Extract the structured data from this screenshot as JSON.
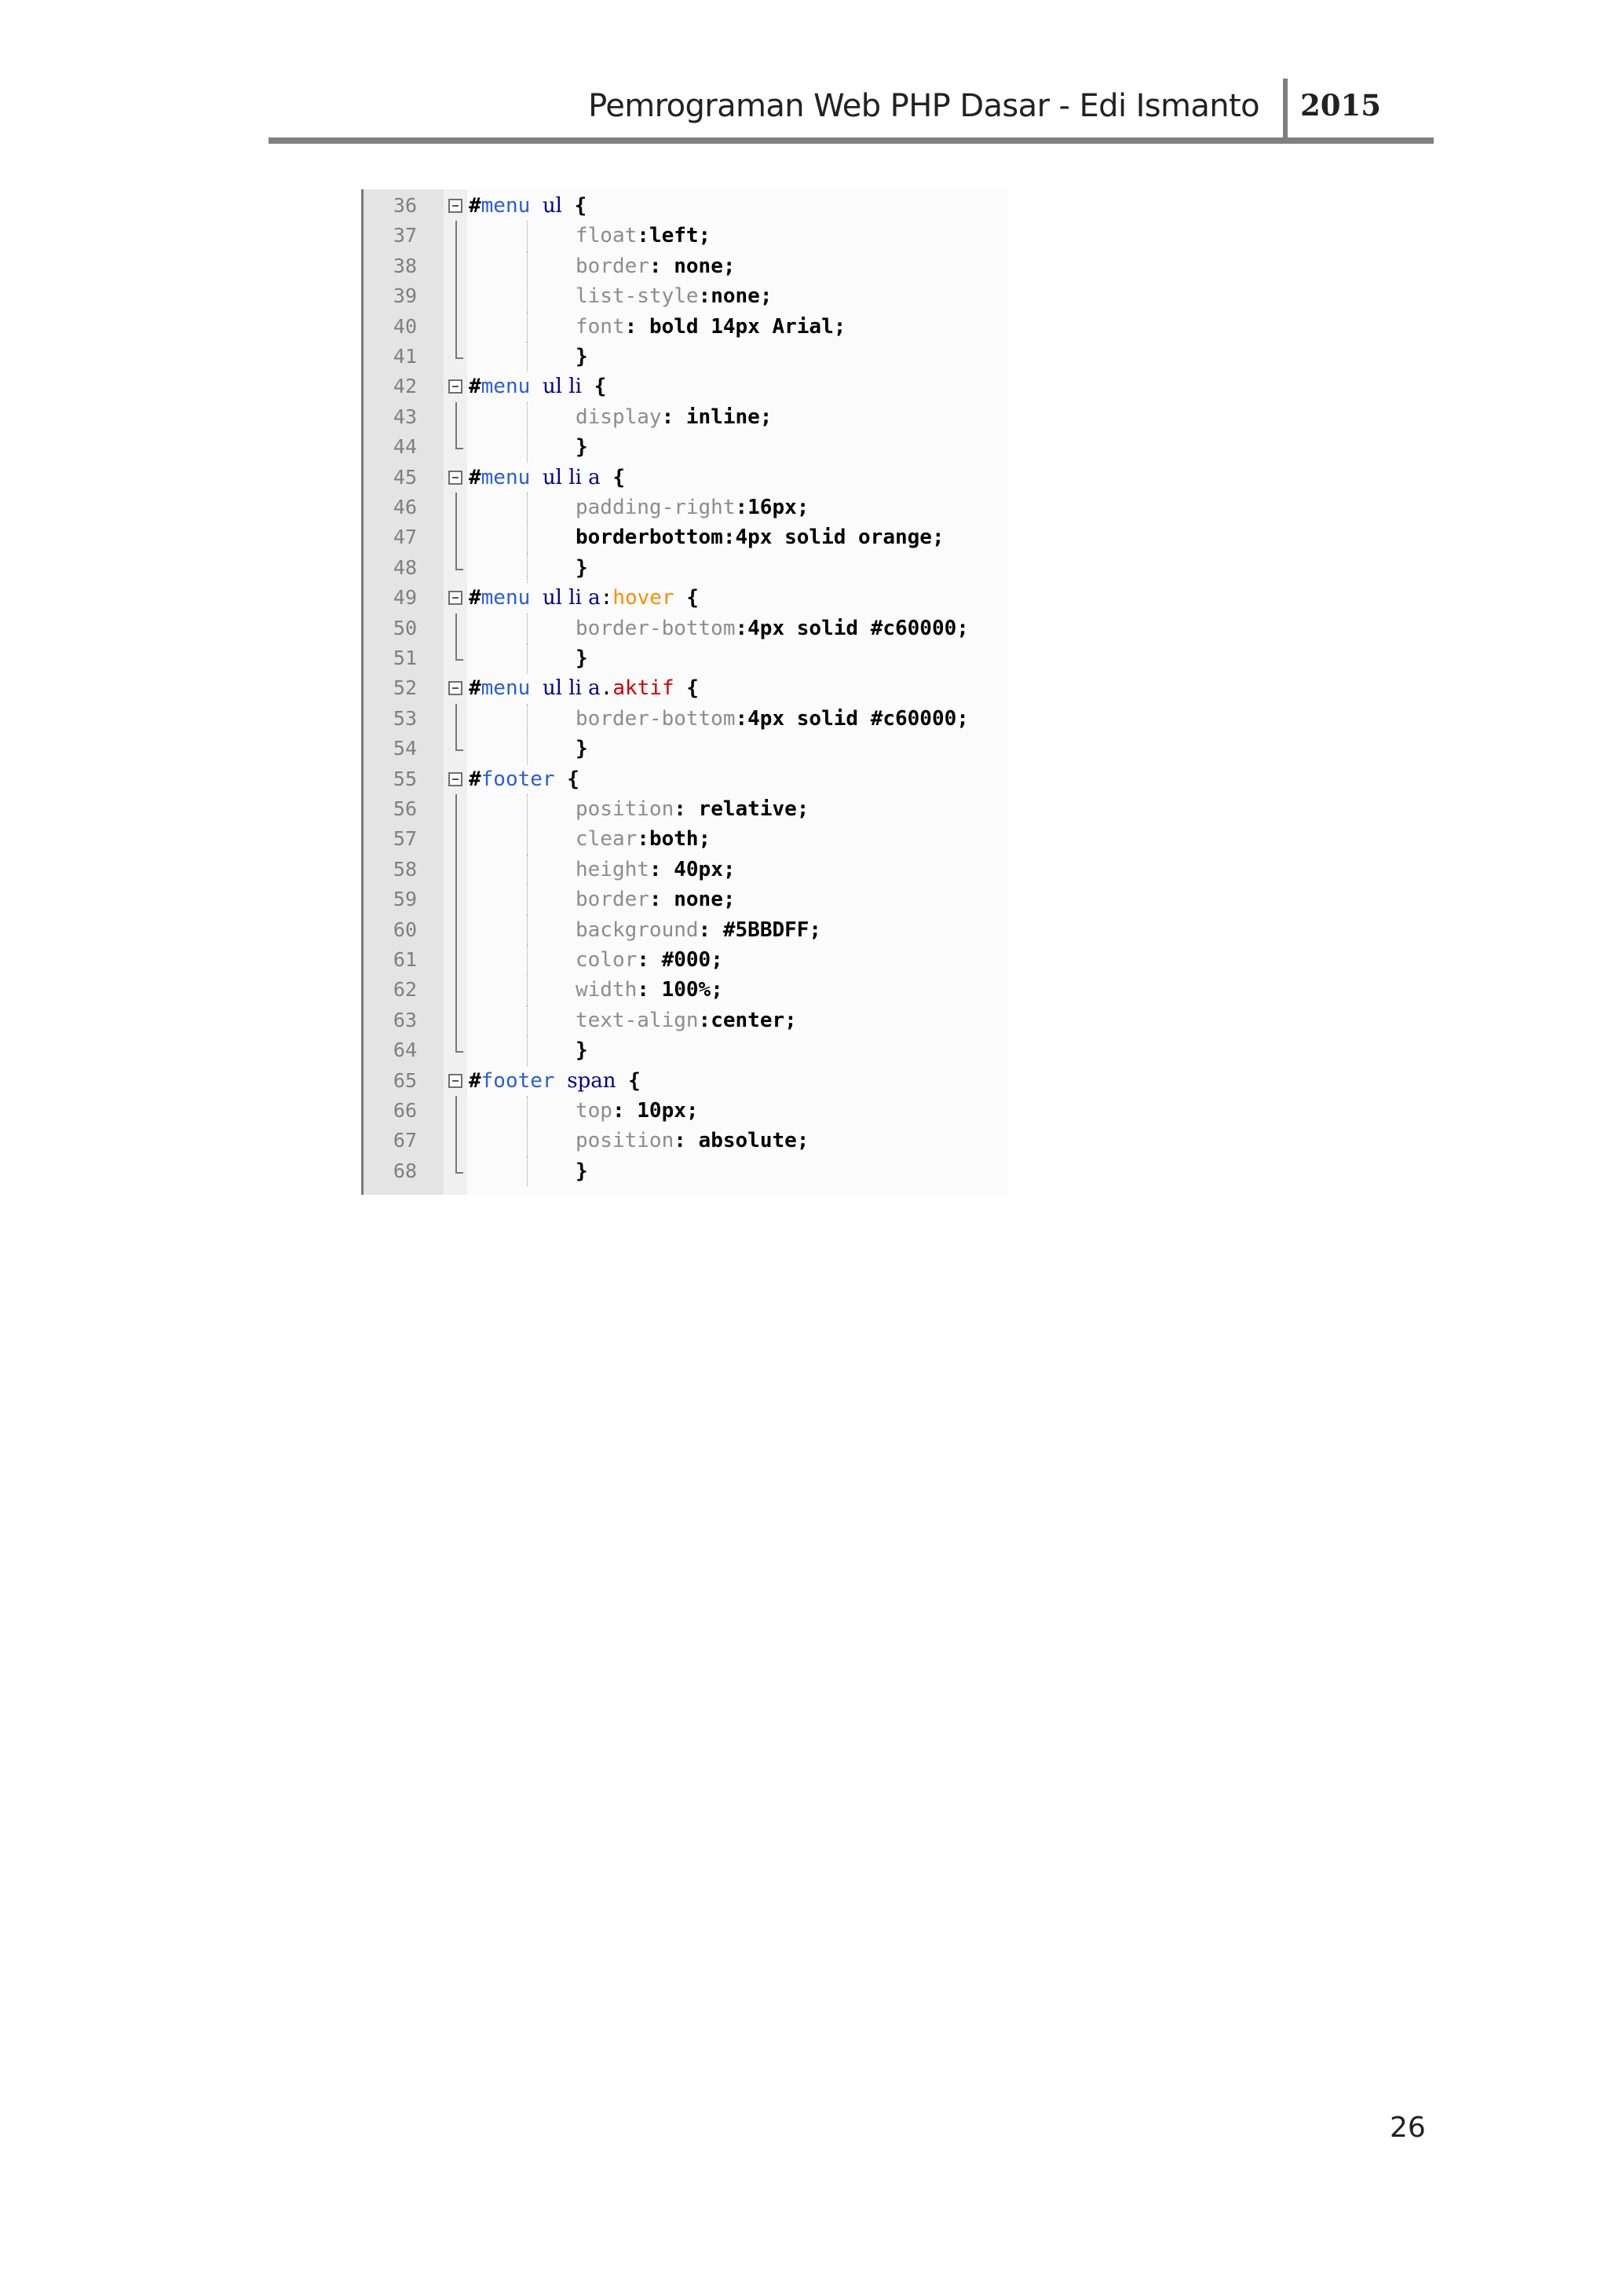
{
  "header": {
    "title": "Pemrograman Web PHP Dasar - Edi Ismanto",
    "year": "2015"
  },
  "code": [
    {
      "num": "36",
      "kind": "selector",
      "sel": [
        {
          "c": "sel-hash",
          "t": "#"
        },
        {
          "c": "sel-name",
          "t": "menu"
        },
        {
          "c": "",
          "t": " "
        },
        {
          "c": "sel-tag",
          "t": "ul"
        },
        {
          "c": "",
          "t": " "
        },
        {
          "c": "brace",
          "t": "{"
        }
      ]
    },
    {
      "num": "37",
      "kind": "decl",
      "prop": "float",
      "sep": ":",
      "val": "left;"
    },
    {
      "num": "38",
      "kind": "decl",
      "prop": "border",
      "sep": ": ",
      "val": "none;"
    },
    {
      "num": "39",
      "kind": "decl",
      "prop": "list-style",
      "sep": ":",
      "val": "none;"
    },
    {
      "num": "40",
      "kind": "decl",
      "prop": "font",
      "sep": ": ",
      "val": "bold 14px Arial;"
    },
    {
      "num": "41",
      "kind": "close",
      "val": "}"
    },
    {
      "num": "42",
      "kind": "selector",
      "sel": [
        {
          "c": "sel-hash",
          "t": "#"
        },
        {
          "c": "sel-name",
          "t": "menu"
        },
        {
          "c": "",
          "t": " "
        },
        {
          "c": "sel-tag",
          "t": "ul li"
        },
        {
          "c": "",
          "t": " "
        },
        {
          "c": "brace",
          "t": "{"
        }
      ]
    },
    {
      "num": "43",
      "kind": "decl",
      "prop": "display",
      "sep": ": ",
      "val": "inline;"
    },
    {
      "num": "44",
      "kind": "close",
      "val": "}"
    },
    {
      "num": "45",
      "kind": "selector",
      "sel": [
        {
          "c": "sel-hash",
          "t": "#"
        },
        {
          "c": "sel-name",
          "t": "menu"
        },
        {
          "c": "",
          "t": " "
        },
        {
          "c": "sel-tag",
          "t": "ul li a"
        },
        {
          "c": "",
          "t": " "
        },
        {
          "c": "brace",
          "t": "{"
        }
      ]
    },
    {
      "num": "46",
      "kind": "decl",
      "prop": "padding-right",
      "sep": ":",
      "val": "16px;"
    },
    {
      "num": "47",
      "kind": "decl",
      "prop": "",
      "sep": "",
      "val": "borderbottom:4px solid orange;"
    },
    {
      "num": "48",
      "kind": "close",
      "val": "}"
    },
    {
      "num": "49",
      "kind": "selector",
      "sel": [
        {
          "c": "sel-hash",
          "t": "#"
        },
        {
          "c": "sel-name",
          "t": "menu"
        },
        {
          "c": "",
          "t": " "
        },
        {
          "c": "sel-tag",
          "t": "ul li a"
        },
        {
          "c": "",
          "t": ":"
        },
        {
          "c": "pseudo",
          "t": "hover"
        },
        {
          "c": "",
          "t": " "
        },
        {
          "c": "brace",
          "t": "{"
        }
      ]
    },
    {
      "num": "50",
      "kind": "decl",
      "prop": "border-bottom",
      "sep": ":",
      "val": "4px solid #c60000;"
    },
    {
      "num": "51",
      "kind": "close",
      "val": "}"
    },
    {
      "num": "52",
      "kind": "selector",
      "sel": [
        {
          "c": "sel-hash",
          "t": "#"
        },
        {
          "c": "sel-name",
          "t": "menu"
        },
        {
          "c": "",
          "t": " "
        },
        {
          "c": "sel-tag",
          "t": "ul li a"
        },
        {
          "c": "",
          "t": "."
        },
        {
          "c": "cls",
          "t": "aktif"
        },
        {
          "c": "",
          "t": " "
        },
        {
          "c": "brace",
          "t": "{"
        }
      ]
    },
    {
      "num": "53",
      "kind": "decl",
      "prop": "border-bottom",
      "sep": ":",
      "val": "4px solid #c60000;"
    },
    {
      "num": "54",
      "kind": "close",
      "val": "}"
    },
    {
      "num": "55",
      "kind": "selector",
      "sel": [
        {
          "c": "sel-hash",
          "t": "#"
        },
        {
          "c": "sel-name",
          "t": "footer"
        },
        {
          "c": "",
          "t": " "
        },
        {
          "c": "brace",
          "t": "{"
        }
      ]
    },
    {
      "num": "56",
      "kind": "decl",
      "prop": "position",
      "sep": ": ",
      "val": "relative;"
    },
    {
      "num": "57",
      "kind": "decl",
      "prop": "clear",
      "sep": ":",
      "val": "both;"
    },
    {
      "num": "58",
      "kind": "decl",
      "prop": "height",
      "sep": ": ",
      "val": "40px;"
    },
    {
      "num": "59",
      "kind": "decl",
      "prop": "border",
      "sep": ": ",
      "val": "none;"
    },
    {
      "num": "60",
      "kind": "decl",
      "prop": "background",
      "sep": ": ",
      "val": "#5BBDFF;"
    },
    {
      "num": "61",
      "kind": "decl",
      "prop": "color",
      "sep": ": ",
      "val": "#000;"
    },
    {
      "num": "62",
      "kind": "decl",
      "prop": "width",
      "sep": ": ",
      "val": "100%;"
    },
    {
      "num": "63",
      "kind": "decl",
      "prop": "text-align",
      "sep": ":",
      "val": "center;"
    },
    {
      "num": "64",
      "kind": "close",
      "val": "}"
    },
    {
      "num": "65",
      "kind": "selector",
      "sel": [
        {
          "c": "sel-hash",
          "t": "#"
        },
        {
          "c": "sel-name",
          "t": "footer"
        },
        {
          "c": "",
          "t": " "
        },
        {
          "c": "sel-tag",
          "t": "span"
        },
        {
          "c": "",
          "t": " "
        },
        {
          "c": "brace",
          "t": "{"
        }
      ]
    },
    {
      "num": "66",
      "kind": "decl",
      "prop": "top",
      "sep": ": ",
      "val": "10px;"
    },
    {
      "num": "67",
      "kind": "decl",
      "prop": "position",
      "sep": ": ",
      "val": "absolute;"
    },
    {
      "num": "68",
      "kind": "close",
      "val": "}"
    }
  ],
  "page_number": "26"
}
